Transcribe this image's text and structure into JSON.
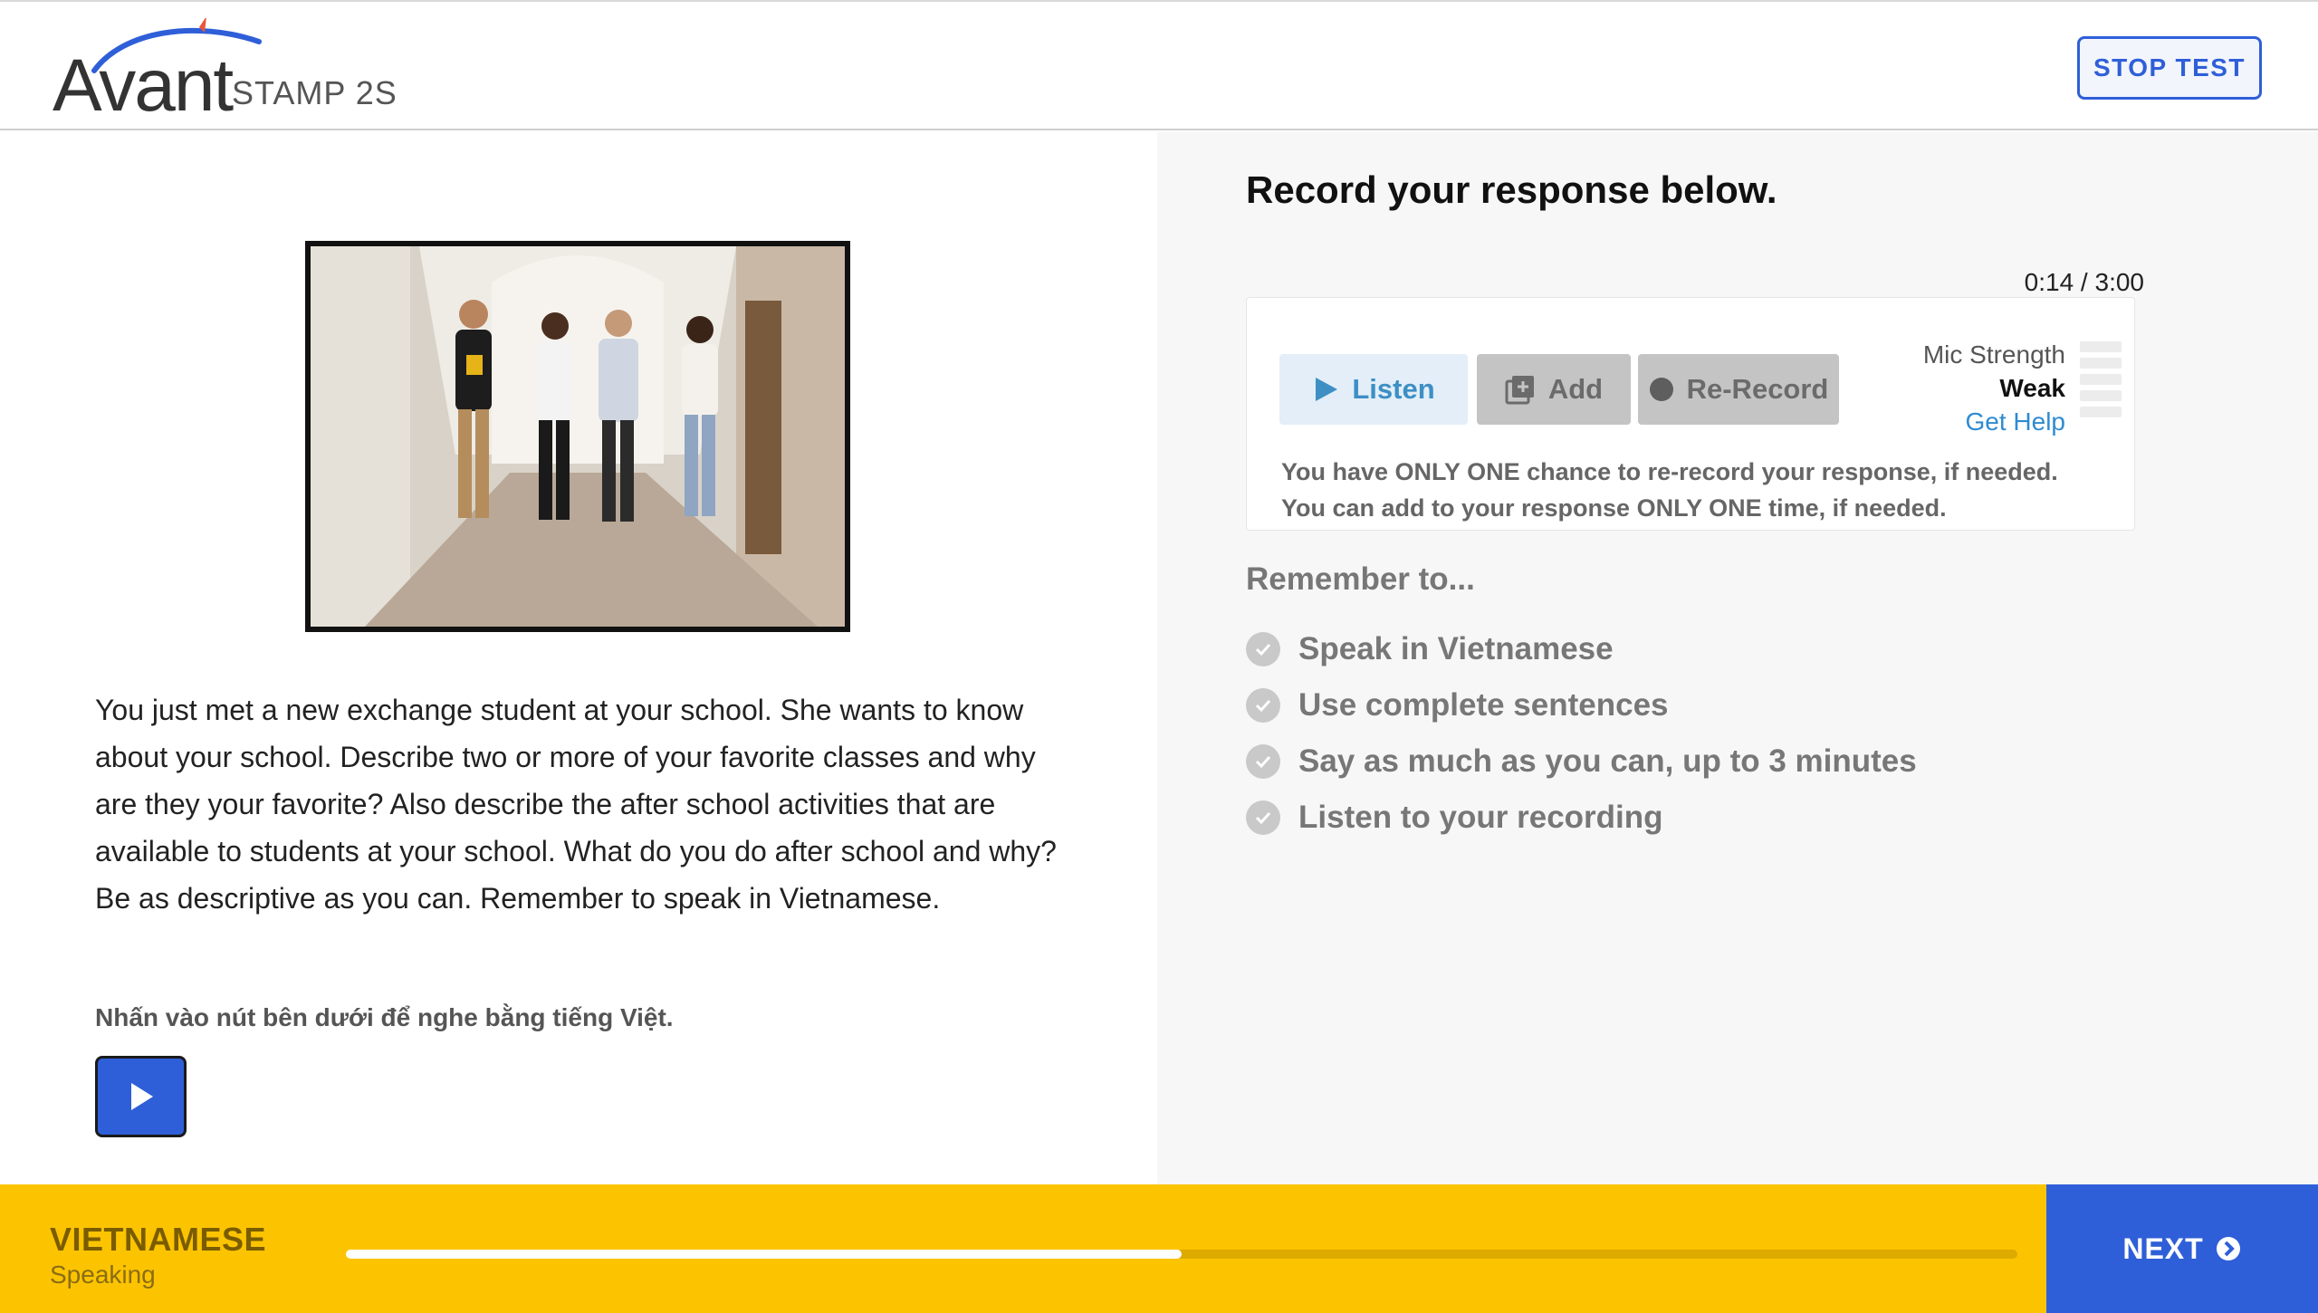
{
  "header": {
    "brand": "Avant",
    "product": "STAMP 2S",
    "stop_label": "STOP TEST"
  },
  "left": {
    "image_icon": "photo-students-walking",
    "prompt": "You just met a new exchange student at your school. She wants to know about your school. Describe two or more of your favorite classes and why are they your favorite? Also describe the after school activities that are available to students at your school. What do you do after school and why? Be as descriptive as you can. Remember to speak in Vietnamese.",
    "instruction": "Nhấn vào nút bên dưới để nghe bằng tiếng Việt.",
    "play_icon": "play-icon"
  },
  "right": {
    "title": "Record your response below.",
    "timer": "0:14 / 3:00",
    "buttons": {
      "listen": "Listen",
      "add": "Add",
      "rerecord": "Re-Record"
    },
    "mic": {
      "label": "Mic Strength",
      "level": "Weak",
      "help": "Get Help"
    },
    "notes": [
      "You have ONLY ONE chance to re-record your response, if needed.",
      "You can add to your response ONLY ONE time, if needed."
    ],
    "remember_title": "Remember to...",
    "checklist": [
      "Speak in Vietnamese",
      "Use complete sentences",
      "Say as much as you can, up to 3 minutes",
      "Listen to your recording"
    ]
  },
  "footer": {
    "language": "VIETNAMESE",
    "section": "Speaking",
    "progress_fraction": 0.5,
    "next_label": "NEXT"
  },
  "colors": {
    "accent": "#2f5fd8",
    "footer": "#fcc400",
    "listen": "#3d8fc4"
  }
}
